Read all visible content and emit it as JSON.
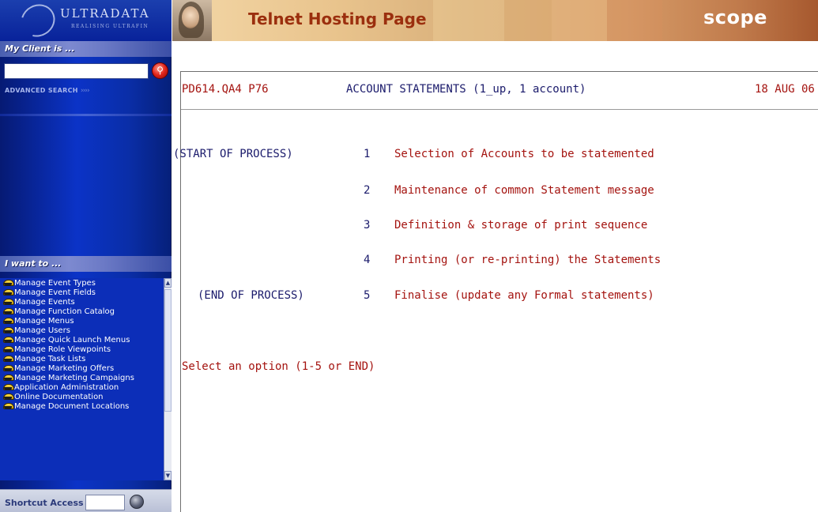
{
  "sidebar": {
    "logo_text": "ULTRADATA",
    "logo_tagline": "REALISING ULTRAFIN",
    "client_header": "My Client is ...",
    "client_input_value": "",
    "advanced_search": "ADVANCED SEARCH",
    "advanced_arrows": "››››",
    "want_header": "I want to ...",
    "menu_items": [
      "Manage Event Types",
      "Manage Event Fields",
      "Manage Events",
      "Manage Function Catalog",
      "Manage Menus",
      "Manage Users",
      "Manage Quick Launch Menus",
      "Manage Role Viewpoints",
      "Manage Task Lists",
      "Manage Marketing Offers",
      "Manage Marketing Campaigns",
      "Application Administration",
      "Online Documentation",
      "Manage Document Locations"
    ],
    "shortcut_label": "Shortcut Access",
    "shortcut_value": ""
  },
  "banner": {
    "title": "Telnet Hosting Page",
    "logo": "scope"
  },
  "terminal": {
    "header_code": "PD614.QA4 P76",
    "header_title": "ACCOUNT STATEMENTS (1_up, 1 account)",
    "header_date": "18 AUG 06",
    "start_label": "(START OF PROCESS)",
    "end_label": "(END OF PROCESS)",
    "options": [
      {
        "num": "1",
        "label": "Selection of Accounts to be statemented"
      },
      {
        "num": "2",
        "label": "Maintenance of common Statement message"
      },
      {
        "num": "3",
        "label": "Definition & storage of print sequence"
      },
      {
        "num": "4",
        "label": "Printing (or re-printing) the Statements"
      },
      {
        "num": "5",
        "label": "Finalise (update any Formal statements)"
      }
    ],
    "prompt": "Select an option (1-5 or END)"
  },
  "colors": {
    "sidebar_blue": "#0b33c7",
    "terminal_red": "#a4130f",
    "terminal_navy": "#1a1a6b",
    "banner_title": "#9b2f0e"
  }
}
